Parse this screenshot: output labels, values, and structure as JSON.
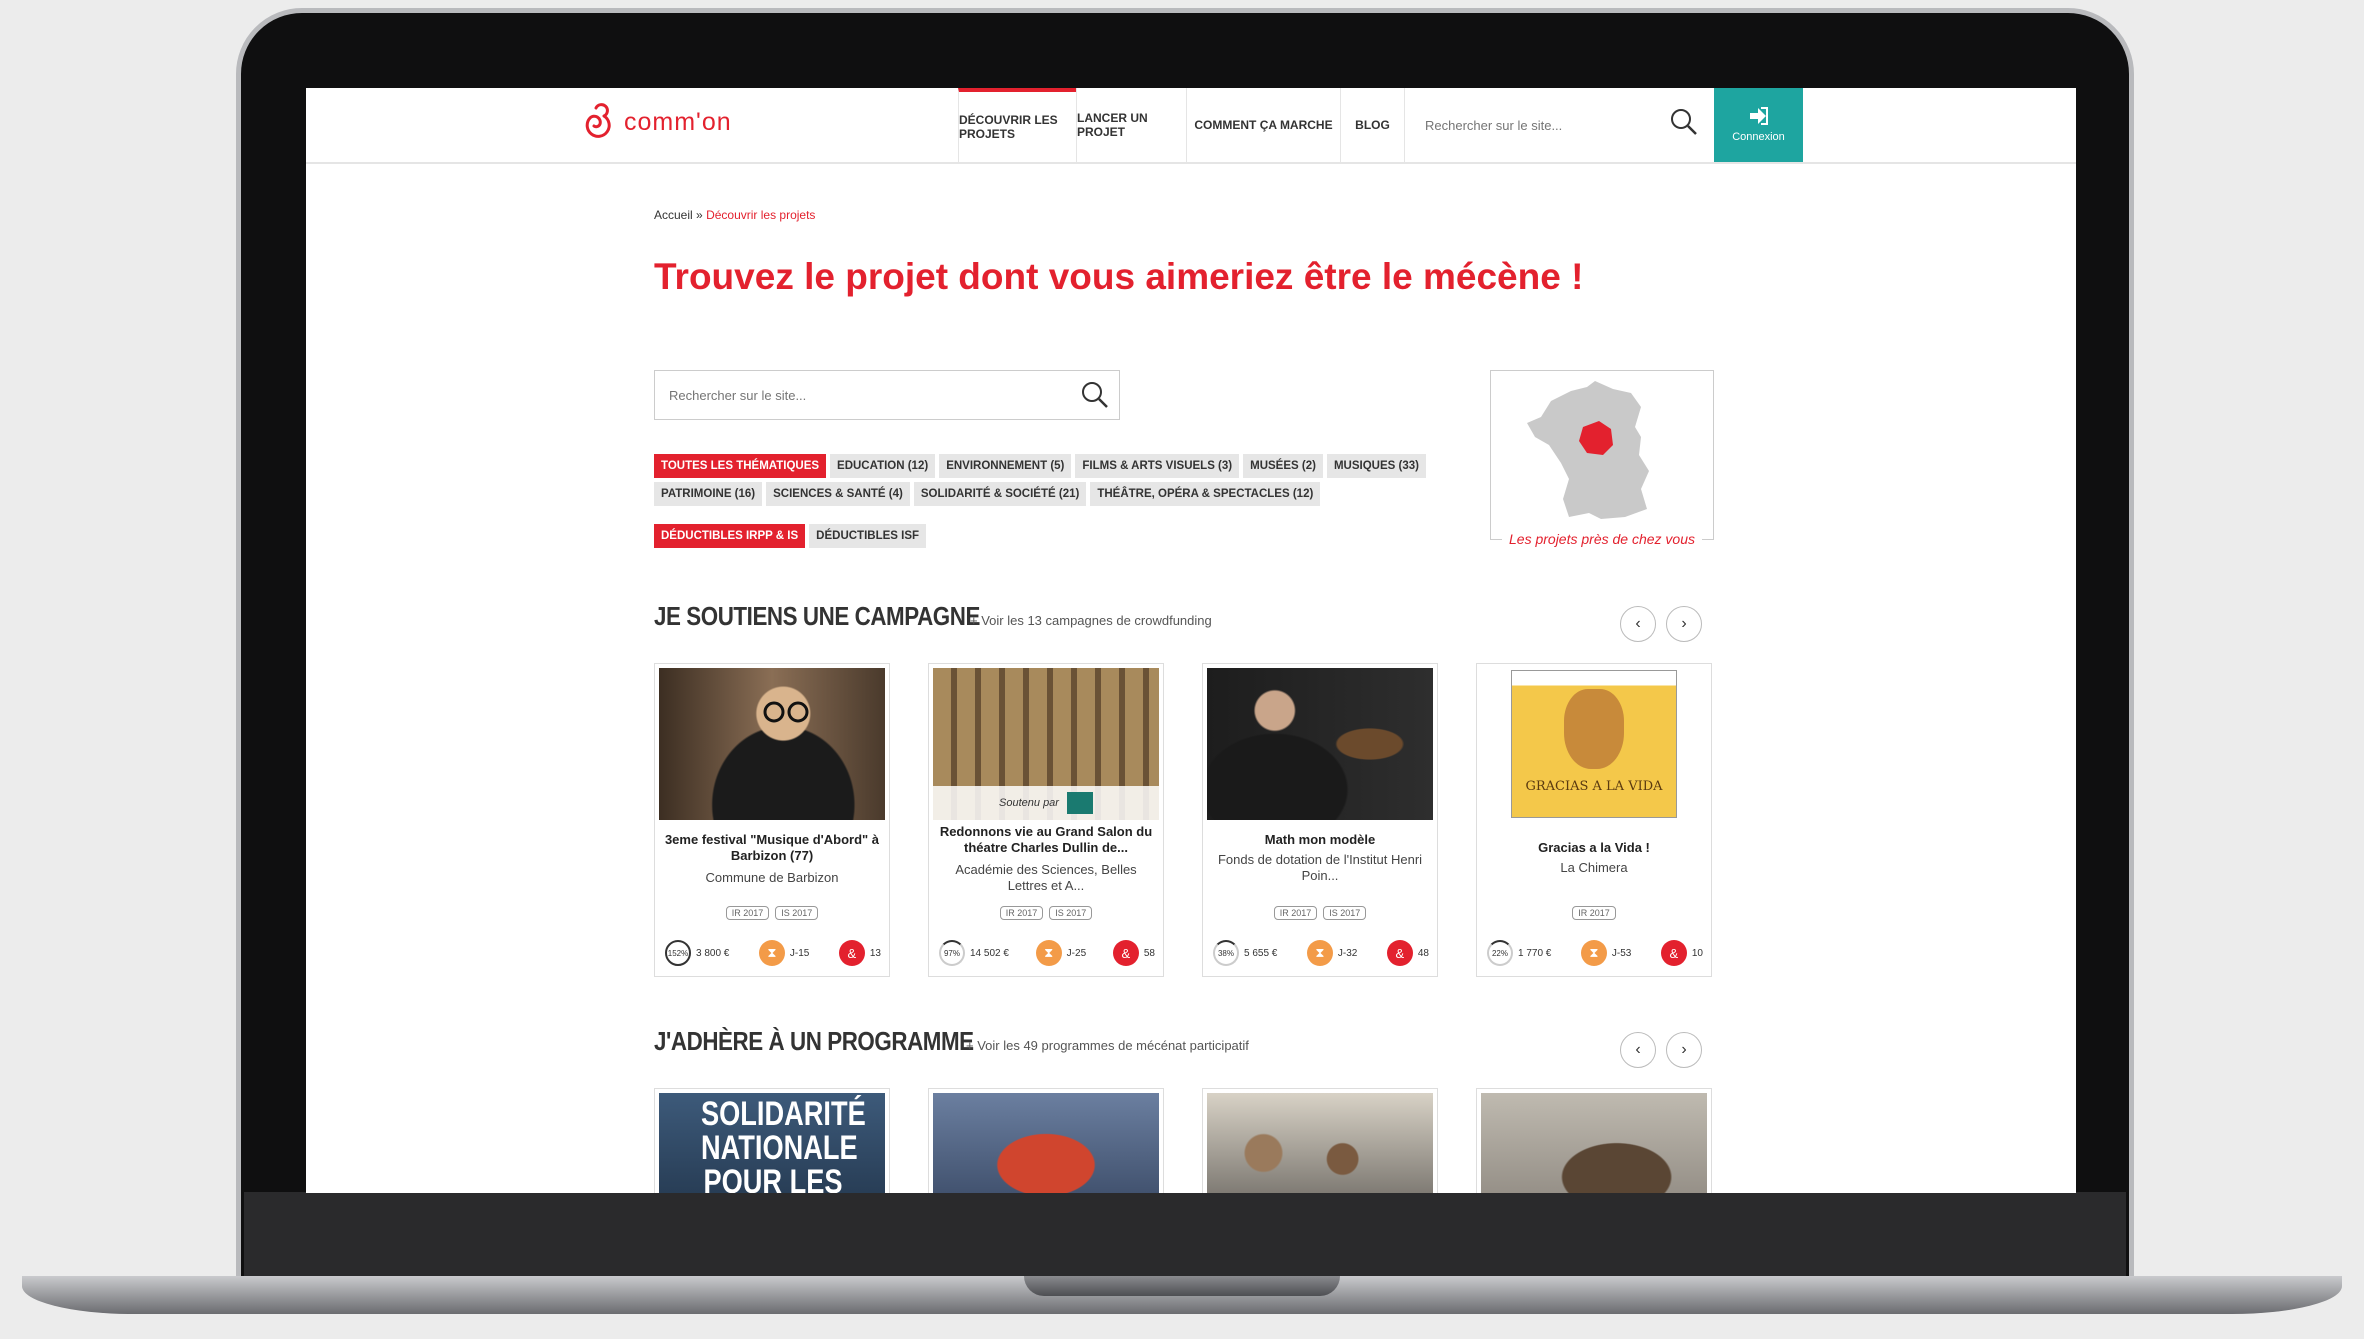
{
  "nav": {
    "logo_text": "comm'on",
    "items": [
      "DÉCOUVRIR LES PROJETS",
      "LANCER UN PROJET",
      "COMMENT ÇA MARCHE",
      "BLOG"
    ],
    "search_placeholder": "Rechercher sur le site...",
    "connexion_label": "Connexion"
  },
  "breadcrumb": {
    "home": "Accueil",
    "separator": "»",
    "current": "Découvrir les projets"
  },
  "page_title": "Trouvez le projet dont vous aimeriez être le mécène !",
  "search": {
    "placeholder": "Rechercher sur le site..."
  },
  "filters": {
    "row1": [
      "TOUTES LES THÉMATIQUES",
      "EDUCATION (12)",
      "ENVIRONNEMENT (5)",
      "FILMS & ARTS VISUELS (3)",
      "MUSÉES (2)",
      "MUSIQUES (33)"
    ],
    "row2": [
      "PATRIMOINE (16)",
      "SCIENCES & SANTÉ (4)",
      "SOLIDARITÉ & SOCIÉTÉ (21)",
      "THÉÂTRE, OPÉRA & SPECTACLES (12)"
    ],
    "fiscal": [
      "DÉDUCTIBLES IRPP & IS",
      "DÉDUCTIBLES ISF"
    ]
  },
  "map": {
    "label": "Les projets près de chez vous"
  },
  "campaigns": {
    "title": "JE SOUTIENS UNE CAMPAGNE",
    "link": "+ Voir les 13 campagnes de crowdfunding",
    "cards": [
      {
        "title": "3eme festival \"Musique d'Abord\" à Barbizon (77)",
        "org": "Commune de Barbizon",
        "tags": [
          "IR 2017",
          "IS 2017"
        ],
        "percent": "152%",
        "amount": "3 800 €",
        "days": "J-15",
        "donors": "13"
      },
      {
        "title": "Redonnons vie au Grand Salon du théatre Charles Dullin de...",
        "org": "Académie des Sciences, Belles Lettres et A...",
        "tags": [
          "IR 2017",
          "IS 2017"
        ],
        "percent": "97%",
        "amount": "14 502 €",
        "days": "J-25",
        "donors": "58",
        "sponsor_label": "Soutenu par"
      },
      {
        "title": "Math mon modèle",
        "org": "Fonds de dotation de l'Institut Henri Poin...",
        "tags": [
          "IR 2017",
          "IS 2017"
        ],
        "percent": "38%",
        "amount": "5 655 €",
        "days": "J-32",
        "donors": "48"
      },
      {
        "title": "Gracias a la Vida !",
        "org": "La Chimera",
        "tags": [
          "IR 2017"
        ],
        "percent": "22%",
        "amount": "1 770 €",
        "days": "J-53",
        "donors": "10",
        "poster_text": "GRACIAS A LA VIDA"
      }
    ]
  },
  "programmes": {
    "title": "J'ADHÈRE À UN PROGRAMME",
    "link": "+ Voir les 49 programmes de mécénat participatif",
    "card1_text": "SOLIDARITÉ NATIONALE POUR LES"
  }
}
